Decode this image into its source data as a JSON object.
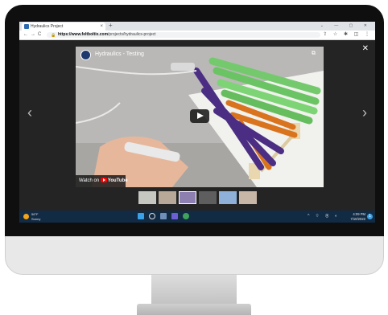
{
  "browser": {
    "tab_title": "Hydraulics Project",
    "tab_close": "×",
    "new_tab": "+",
    "window_controls": "⌄ — ▢ ✕",
    "nav_back": "←",
    "nav_forward": "→",
    "nav_reload": "C",
    "url_host": "https://www.feltboltix.com",
    "url_path": "/projects/hydraulics-project",
    "toolbar_icons": "⇪ ☆ ✱ ◫ ⋮"
  },
  "lightbox": {
    "close": "✕",
    "prev": "‹",
    "next": "›",
    "video": {
      "title": "Hydraulics - Testing",
      "copy_icon": "⧉",
      "watch_on_label": "Watch on",
      "youtube_label": "YouTube"
    },
    "thumbnails": [
      {
        "selected": false
      },
      {
        "selected": false
      },
      {
        "selected": true
      },
      {
        "selected": false
      },
      {
        "selected": false
      },
      {
        "selected": false
      }
    ]
  },
  "taskbar": {
    "weather_temp": "56°F",
    "weather_condition": "Sunny",
    "tray_icons": "^ ⌔ ◉ ◐",
    "time": "4:09 PM",
    "date": "7/10/2022",
    "notification_count": "1"
  },
  "colors": {
    "taskbar": "#122b45",
    "popsicle_green": "#6fcf6a",
    "popsicle_purple": "#4b2e83",
    "popsicle_orange": "#d9731e"
  }
}
